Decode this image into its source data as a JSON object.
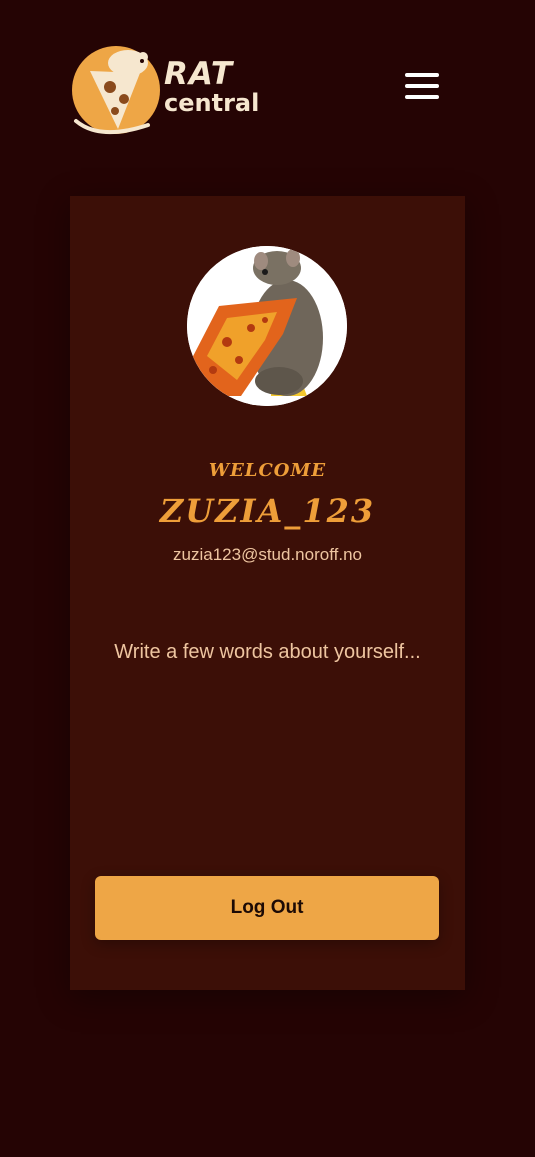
{
  "header": {
    "logo_word_1": "RAT",
    "logo_word_2": "central",
    "menu_icon": "hamburger-menu-icon"
  },
  "profile": {
    "welcome": "WELCOME",
    "username": "ZUZIA_123",
    "email": "zuzia123@stud.noroff.no",
    "bio": "Write a few words about yourself..."
  },
  "actions": {
    "logout_label": "Log Out"
  },
  "colors": {
    "background": "#250404",
    "card": "#3c0f07",
    "accent": "#ee9e39",
    "button": "#eea646"
  }
}
